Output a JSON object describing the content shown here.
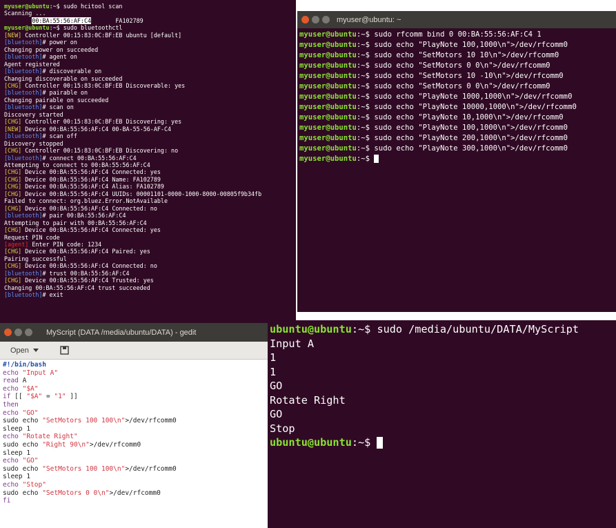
{
  "terminal_left": {
    "lines": [
      {
        "segments": [
          {
            "text": "myuser@ubuntu",
            "class": "green"
          },
          {
            "text": ":~$ sudo hcitool scan",
            "class": ""
          }
        ]
      },
      {
        "segments": [
          {
            "text": "Scanning ...",
            "class": ""
          }
        ]
      },
      {
        "segments": [
          {
            "text": "        ",
            "class": ""
          },
          {
            "text": "00:BA:55:56:AF:C4",
            "class": "hilite"
          },
          {
            "text": "       FA102789",
            "class": ""
          }
        ]
      },
      {
        "segments": [
          {
            "text": "myuser@ubuntu",
            "class": "green"
          },
          {
            "text": ":~$ sudo bluetoothctl",
            "class": ""
          }
        ]
      },
      {
        "segments": [
          {
            "text": "[NEW]",
            "class": "yellow"
          },
          {
            "text": " Controller 00:15:83:0C:BF:EB ubuntu [default]",
            "class": ""
          }
        ]
      },
      {
        "segments": [
          {
            "text": "[bluetooth]",
            "class": "blue"
          },
          {
            "text": "# power on",
            "class": ""
          }
        ]
      },
      {
        "segments": [
          {
            "text": "Changing power on succeeded",
            "class": ""
          }
        ]
      },
      {
        "segments": [
          {
            "text": "[bluetooth]",
            "class": "blue"
          },
          {
            "text": "# agent on",
            "class": ""
          }
        ]
      },
      {
        "segments": [
          {
            "text": "Agent registered",
            "class": ""
          }
        ]
      },
      {
        "segments": [
          {
            "text": "[bluetooth]",
            "class": "blue"
          },
          {
            "text": "# discoverable on",
            "class": ""
          }
        ]
      },
      {
        "segments": [
          {
            "text": "Changing discoverable on succeeded",
            "class": ""
          }
        ]
      },
      {
        "segments": [
          {
            "text": "[CHG]",
            "class": "yellow"
          },
          {
            "text": " Controller 00:15:83:0C:BF:EB Discoverable: yes",
            "class": ""
          }
        ]
      },
      {
        "segments": [
          {
            "text": "[bluetooth]",
            "class": "blue"
          },
          {
            "text": "# pairable on",
            "class": ""
          }
        ]
      },
      {
        "segments": [
          {
            "text": "Changing pairable on succeeded",
            "class": ""
          }
        ]
      },
      {
        "segments": [
          {
            "text": "[bluetooth]",
            "class": "blue"
          },
          {
            "text": "# scan on",
            "class": ""
          }
        ]
      },
      {
        "segments": [
          {
            "text": "Discovery started",
            "class": ""
          }
        ]
      },
      {
        "segments": [
          {
            "text": "[CHG]",
            "class": "yellow"
          },
          {
            "text": " Controller 00:15:83:0C:BF:EB Discovering: yes",
            "class": ""
          }
        ]
      },
      {
        "segments": [
          {
            "text": "[NEW]",
            "class": "yellow"
          },
          {
            "text": " Device 00:BA:55:56:AF:C4 00-BA-55-56-AF-C4",
            "class": ""
          }
        ]
      },
      {
        "segments": [
          {
            "text": "[bluetooth]",
            "class": "blue"
          },
          {
            "text": "# scan off",
            "class": ""
          }
        ]
      },
      {
        "segments": [
          {
            "text": "Discovery stopped",
            "class": ""
          }
        ]
      },
      {
        "segments": [
          {
            "text": "[CHG]",
            "class": "yellow"
          },
          {
            "text": " Controller 00:15:83:0C:BF:EB Discovering: no",
            "class": ""
          }
        ]
      },
      {
        "segments": [
          {
            "text": "[bluetooth]",
            "class": "blue"
          },
          {
            "text": "# connect 00:BA:55:56:AF:C4",
            "class": ""
          }
        ]
      },
      {
        "segments": [
          {
            "text": "Attempting to connect to 00:BA:55:56:AF:C4",
            "class": ""
          }
        ]
      },
      {
        "segments": [
          {
            "text": "[CHG]",
            "class": "yellow"
          },
          {
            "text": " Device 00:BA:55:56:AF:C4 Connected: yes",
            "class": ""
          }
        ]
      },
      {
        "segments": [
          {
            "text": "[CHG]",
            "class": "yellow"
          },
          {
            "text": " Device 00:BA:55:56:AF:C4 Name: FA102789",
            "class": ""
          }
        ]
      },
      {
        "segments": [
          {
            "text": "[CHG]",
            "class": "yellow"
          },
          {
            "text": " Device 00:BA:55:56:AF:C4 Alias: FA102789",
            "class": ""
          }
        ]
      },
      {
        "segments": [
          {
            "text": "[CHG]",
            "class": "yellow"
          },
          {
            "text": " Device 00:BA:55:56:AF:C4 UUIDs: 00001101-0000-1000-8000-00805f9b34fb",
            "class": ""
          }
        ]
      },
      {
        "segments": [
          {
            "text": "Failed to connect: org.bluez.Error.NotAvailable",
            "class": ""
          }
        ]
      },
      {
        "segments": [
          {
            "text": "[CHG]",
            "class": "yellow"
          },
          {
            "text": " Device 00:BA:55:56:AF:C4 Connected: no",
            "class": ""
          }
        ]
      },
      {
        "segments": [
          {
            "text": "[bluetooth]",
            "class": "blue"
          },
          {
            "text": "# pair 00:BA:55:56:AF:C4",
            "class": ""
          }
        ]
      },
      {
        "segments": [
          {
            "text": "Attempting to pair with 00:BA:55:56:AF:C4",
            "class": ""
          }
        ]
      },
      {
        "segments": [
          {
            "text": "[CHG]",
            "class": "yellow"
          },
          {
            "text": " Device 00:BA:55:56:AF:C4 Connected: yes",
            "class": ""
          }
        ]
      },
      {
        "segments": [
          {
            "text": "Request PIN code",
            "class": ""
          }
        ]
      },
      {
        "segments": [
          {
            "text": "[agent]",
            "class": "red"
          },
          {
            "text": " Enter PIN code: 1234",
            "class": ""
          }
        ]
      },
      {
        "segments": [
          {
            "text": "[CHG]",
            "class": "yellow"
          },
          {
            "text": " Device 00:BA:55:56:AF:C4 Paired: yes",
            "class": ""
          }
        ]
      },
      {
        "segments": [
          {
            "text": "Pairing successful",
            "class": ""
          }
        ]
      },
      {
        "segments": [
          {
            "text": "[CHG]",
            "class": "yellow"
          },
          {
            "text": " Device 00:BA:55:56:AF:C4 Connected: no",
            "class": ""
          }
        ]
      },
      {
        "segments": [
          {
            "text": "[bluetooth]",
            "class": "blue"
          },
          {
            "text": "# trust 00:BA:55:56:AF:C4",
            "class": ""
          }
        ]
      },
      {
        "segments": [
          {
            "text": "[CHG]",
            "class": "yellow"
          },
          {
            "text": " Device 00:BA:55:56:AF:C4 Trusted: yes",
            "class": ""
          }
        ]
      },
      {
        "segments": [
          {
            "text": "Changing 00:BA:55:56:AF:C4 trust succeeded",
            "class": ""
          }
        ]
      },
      {
        "segments": [
          {
            "text": "[bluetooth]",
            "class": "blue"
          },
          {
            "text": "# exit",
            "class": ""
          }
        ]
      }
    ]
  },
  "terminal_right": {
    "title": "myuser@ubuntu: ~",
    "lines": [
      {
        "segments": [
          {
            "text": "myuser@ubuntu",
            "class": "green"
          },
          {
            "text": ":~$ sudo rfcomm bind 0 00:BA:55:56:AF:C4 1",
            "class": ""
          }
        ]
      },
      {
        "segments": [
          {
            "text": "myuser@ubuntu",
            "class": "green"
          },
          {
            "text": ":~$ sudo echo \"PlayNote 100,1000\\n\">/dev/rfcomm0",
            "class": ""
          }
        ]
      },
      {
        "segments": [
          {
            "text": "myuser@ubuntu",
            "class": "green"
          },
          {
            "text": ":~$ sudo echo \"SetMotors 10 10\\n\">/dev/rfcomm0",
            "class": ""
          }
        ]
      },
      {
        "segments": [
          {
            "text": "myuser@ubuntu",
            "class": "green"
          },
          {
            "text": ":~$ sudo echo \"SetMotors 0 0\\n\">/dev/rfcomm0",
            "class": ""
          }
        ]
      },
      {
        "segments": [
          {
            "text": "myuser@ubuntu",
            "class": "green"
          },
          {
            "text": ":~$ sudo echo \"SetMotors 10 -10\\n\">/dev/rfcomm0",
            "class": ""
          }
        ]
      },
      {
        "segments": [
          {
            "text": "myuser@ubuntu",
            "class": "green"
          },
          {
            "text": ":~$ sudo echo \"SetMotors 0 0\\n\">/dev/rfcomm0",
            "class": ""
          }
        ]
      },
      {
        "segments": [
          {
            "text": "myuser@ubuntu",
            "class": "green"
          },
          {
            "text": ":~$ sudo echo \"PlayNote 1000,1000\\n\">/dev/rfcomm0",
            "class": ""
          }
        ]
      },
      {
        "segments": [
          {
            "text": "myuser@ubuntu",
            "class": "green"
          },
          {
            "text": ":~$ sudo echo \"PlayNote 10000,1000\\n\">/dev/rfcomm0",
            "class": ""
          }
        ]
      },
      {
        "segments": [
          {
            "text": "myuser@ubuntu",
            "class": "green"
          },
          {
            "text": ":~$ sudo echo \"PlayNote 10,1000\\n\">/dev/rfcomm0",
            "class": ""
          }
        ]
      },
      {
        "segments": [
          {
            "text": "myuser@ubuntu",
            "class": "green"
          },
          {
            "text": ":~$ sudo echo \"PlayNote 100,1000\\n\">/dev/rfcomm0",
            "class": ""
          }
        ]
      },
      {
        "segments": [
          {
            "text": "myuser@ubuntu",
            "class": "green"
          },
          {
            "text": ":~$ sudo echo \"PlayNote 200,1000\\n\">/dev/rfcomm0",
            "class": ""
          }
        ]
      },
      {
        "segments": [
          {
            "text": "myuser@ubuntu",
            "class": "green"
          },
          {
            "text": ":~$ sudo echo \"PlayNote 300,1000\\n\">/dev/rfcomm0",
            "class": ""
          }
        ]
      },
      {
        "segments": [
          {
            "text": "myuser@ubuntu",
            "class": "green"
          },
          {
            "text": ":~$ ",
            "class": ""
          }
        ],
        "cursor": true
      }
    ]
  },
  "gedit": {
    "title": "MyScript (DATA /media/ubuntu/DATA) - gedit",
    "open_label": "Open",
    "lines": [
      {
        "segments": [
          {
            "text": "#!/bin/bash",
            "class": "shebang"
          }
        ]
      },
      {
        "segments": [
          {
            "text": "echo ",
            "class": "kw"
          },
          {
            "text": "\"Input A\"",
            "class": "str"
          }
        ]
      },
      {
        "segments": [
          {
            "text": "read ",
            "class": "kw"
          },
          {
            "text": "A",
            "class": ""
          }
        ]
      },
      {
        "segments": [
          {
            "text": "echo ",
            "class": "kw"
          },
          {
            "text": "\"$A\"",
            "class": "str"
          }
        ]
      },
      {
        "segments": [
          {
            "text": "if ",
            "class": "kw"
          },
          {
            "text": "[[ ",
            "class": ""
          },
          {
            "text": "\"$A\"",
            "class": "str"
          },
          {
            "text": " = ",
            "class": ""
          },
          {
            "text": "\"1\"",
            "class": "str"
          },
          {
            "text": " ]]",
            "class": ""
          }
        ]
      },
      {
        "segments": [
          {
            "text": "then",
            "class": "kw"
          }
        ]
      },
      {
        "segments": [
          {
            "text": "echo ",
            "class": "kw"
          },
          {
            "text": "\"GO\"",
            "class": "str"
          }
        ]
      },
      {
        "segments": [
          {
            "text": "sudo echo ",
            "class": ""
          },
          {
            "text": "\"SetMotors 100 100\\n\"",
            "class": "str"
          },
          {
            "text": ">/dev/rfcomm0",
            "class": ""
          }
        ]
      },
      {
        "segments": [
          {
            "text": "sleep 1",
            "class": ""
          }
        ]
      },
      {
        "segments": [
          {
            "text": "echo ",
            "class": "kw"
          },
          {
            "text": "\"Rotate Right\"",
            "class": "str"
          }
        ]
      },
      {
        "segments": [
          {
            "text": "sudo echo ",
            "class": ""
          },
          {
            "text": "\"Right 90\\n\"",
            "class": "str"
          },
          {
            "text": ">/dev/rfcomm0",
            "class": ""
          }
        ]
      },
      {
        "segments": [
          {
            "text": "sleep 1",
            "class": ""
          }
        ]
      },
      {
        "segments": [
          {
            "text": "echo ",
            "class": "kw"
          },
          {
            "text": "\"GO\"",
            "class": "str"
          }
        ]
      },
      {
        "segments": [
          {
            "text": "sudo echo ",
            "class": ""
          },
          {
            "text": "\"SetMotors 100 100\\n\"",
            "class": "str"
          },
          {
            "text": ">/dev/rfcomm0",
            "class": ""
          }
        ]
      },
      {
        "segments": [
          {
            "text": "sleep 1",
            "class": ""
          }
        ]
      },
      {
        "segments": [
          {
            "text": "echo ",
            "class": "kw"
          },
          {
            "text": "\"Stop\"",
            "class": "str"
          }
        ]
      },
      {
        "segments": [
          {
            "text": "sudo echo ",
            "class": ""
          },
          {
            "text": "\"SetMotors 0 0\\n\"",
            "class": "str"
          },
          {
            "text": ">/dev/rfcomm0",
            "class": ""
          }
        ]
      },
      {
        "segments": [
          {
            "text": "fi",
            "class": "kw"
          }
        ]
      }
    ]
  },
  "terminal_bottom": {
    "lines": [
      {
        "segments": [
          {
            "text": "ubuntu@ubuntu",
            "class": "green"
          },
          {
            "text": ":~$ sudo /media/ubuntu/DATA/MyScript",
            "class": ""
          }
        ]
      },
      {
        "segments": [
          {
            "text": "Input A",
            "class": ""
          }
        ]
      },
      {
        "segments": [
          {
            "text": "1",
            "class": ""
          }
        ]
      },
      {
        "segments": [
          {
            "text": "1",
            "class": ""
          }
        ]
      },
      {
        "segments": [
          {
            "text": "GO",
            "class": ""
          }
        ]
      },
      {
        "segments": [
          {
            "text": "Rotate Right",
            "class": ""
          }
        ]
      },
      {
        "segments": [
          {
            "text": "GO",
            "class": ""
          }
        ]
      },
      {
        "segments": [
          {
            "text": "Stop",
            "class": ""
          }
        ]
      },
      {
        "segments": [
          {
            "text": "ubuntu@ubuntu",
            "class": "green"
          },
          {
            "text": ":~$ ",
            "class": ""
          }
        ],
        "cursor": true
      }
    ]
  },
  "colors": {
    "terminal_bg": "#300a24",
    "prompt_green": "#8ae234",
    "bluetooth_blue": "#5b8df0",
    "tag_yellow": "#e0d046",
    "agent_red": "#ef2929",
    "titlebar": "#3c3b37",
    "close_button": "#e25a2a"
  },
  "icons": [
    "close-icon",
    "minimize-icon",
    "maximize-icon",
    "chevron-down-icon",
    "save-icon",
    "terminal-cursor"
  ]
}
